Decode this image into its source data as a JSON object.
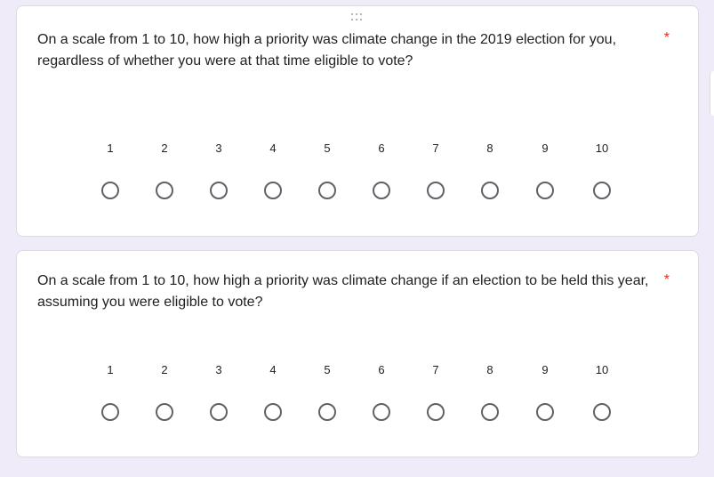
{
  "questions": [
    {
      "text": "On a scale from 1 to 10, how high a priority was climate change in the 2019 election for you, regardless of whether you were at that time eligible to vote?",
      "required_mark": "*",
      "scale": [
        "1",
        "2",
        "3",
        "4",
        "5",
        "6",
        "7",
        "8",
        "9",
        "10"
      ]
    },
    {
      "text": "On a scale from 1 to 10, how high a priority was climate change if an election to be held this year, assuming you were eligible to vote?",
      "required_mark": "*",
      "scale": [
        "1",
        "2",
        "3",
        "4",
        "5",
        "6",
        "7",
        "8",
        "9",
        "10"
      ]
    }
  ],
  "icons": {
    "drag_handle": "drag-handle-icon"
  },
  "colors": {
    "background": "#f0ebf8",
    "required": "#d93025",
    "radio_border": "#5f6368"
  }
}
